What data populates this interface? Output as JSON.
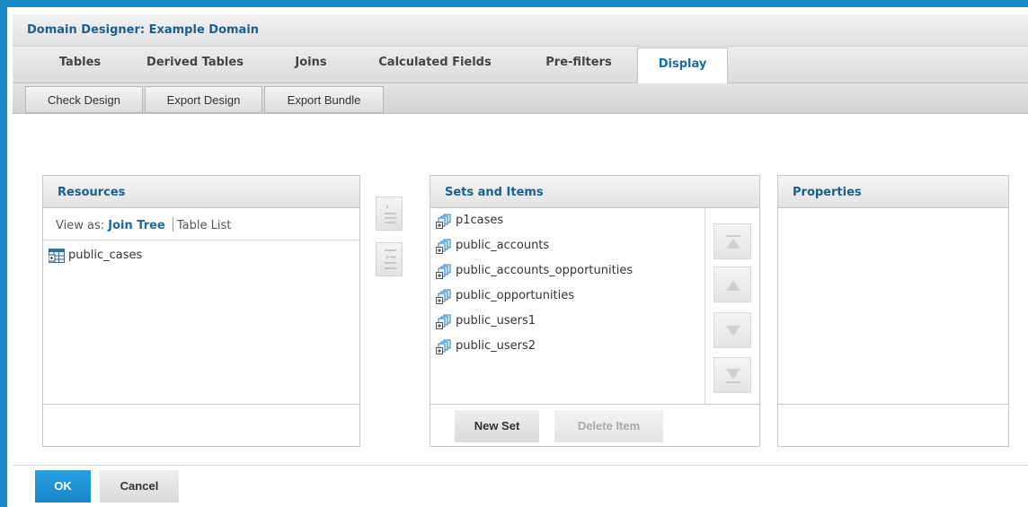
{
  "window": {
    "title": "Domain Designer: Example Domain"
  },
  "tabs": [
    {
      "label": "Tables"
    },
    {
      "label": "Derived Tables"
    },
    {
      "label": "Joins"
    },
    {
      "label": "Calculated Fields"
    },
    {
      "label": "Pre-filters"
    },
    {
      "label": "Display",
      "active": true
    }
  ],
  "toolbar": {
    "check_design": "Check Design",
    "export_design": "Export Design",
    "export_bundle": "Export Bundle"
  },
  "resources": {
    "title": "Resources",
    "view_as_label": "View as:",
    "view_join_tree": "Join Tree",
    "view_table_list": "Table List",
    "items": [
      {
        "label": "public_cases",
        "icon": "join-table-icon"
      }
    ]
  },
  "move_buttons": {
    "add_icon": "add-to-sets-icon",
    "add_all_icon": "add-all-to-sets-icon"
  },
  "sets": {
    "title": "Sets and Items",
    "items": [
      {
        "label": "p1cases",
        "icon": "set-icon"
      },
      {
        "label": "public_accounts",
        "icon": "set-icon"
      },
      {
        "label": "public_accounts_opportunities",
        "icon": "set-icon"
      },
      {
        "label": "public_opportunities",
        "icon": "set-icon"
      },
      {
        "label": "public_users1",
        "icon": "set-icon"
      },
      {
        "label": "public_users2",
        "icon": "set-icon"
      }
    ],
    "new_set": "New Set",
    "delete_item": "Delete Item"
  },
  "properties": {
    "title": "Properties"
  },
  "dialog": {
    "ok": "OK",
    "cancel": "Cancel"
  },
  "colors": {
    "accent": "#1a8ac8",
    "title_text": "#1b5f8e",
    "link": "#1b6aa0"
  }
}
